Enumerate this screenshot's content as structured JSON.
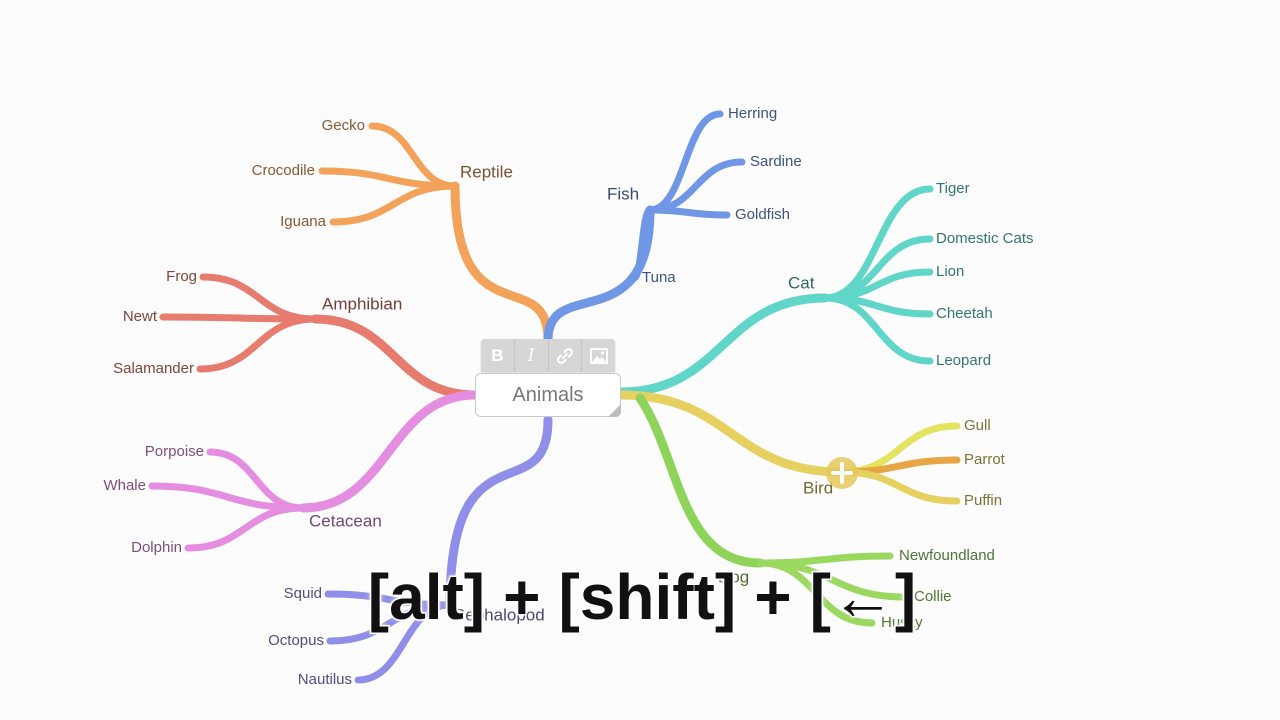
{
  "root": {
    "label": "Animals"
  },
  "toolbar": {
    "bold": "B",
    "italic": "I",
    "link": "link-icon",
    "image": "image-icon"
  },
  "categories": {
    "reptile": {
      "label": "Reptile",
      "children": [
        "Gecko",
        "Crocodile",
        "Iguana"
      ],
      "color": "#f3a25a"
    },
    "fish": {
      "label": "Fish",
      "children": [
        "Herring",
        "Sardine",
        "Goldfish",
        "Tuna"
      ],
      "color": "#6f97e6"
    },
    "amphibian": {
      "label": "Amphibian",
      "children": [
        "Frog",
        "Newt",
        "Salamander"
      ],
      "color": "#e77b6e"
    },
    "cetacean": {
      "label": "Cetacean",
      "children": [
        "Porpoise",
        "Whale",
        "Dolphin"
      ],
      "color": "#e58de0"
    },
    "cephalopod": {
      "label": "Cephalopod",
      "children": [
        "Squid",
        "Octopus",
        "Nautilus"
      ],
      "color": "#8f8ee8"
    },
    "cat": {
      "label": "Cat",
      "children": [
        "Tiger",
        "Domestic Cats",
        "Lion",
        "Cheetah",
        "Leopard"
      ],
      "color": "#5fd6c8"
    },
    "bird": {
      "label": "Bird",
      "children": [
        "Gull",
        "Parrot",
        "Puffin"
      ],
      "color": "#e6d060"
    },
    "dog": {
      "label": "Dog",
      "children": [
        "Newfoundland",
        "Collie",
        "Husky"
      ],
      "color": "#8ed45a"
    }
  },
  "shortcut": {
    "key1": "[alt]",
    "plus1": "+",
    "key2": "[shift]",
    "plus2": "+",
    "key3": "[←]"
  }
}
